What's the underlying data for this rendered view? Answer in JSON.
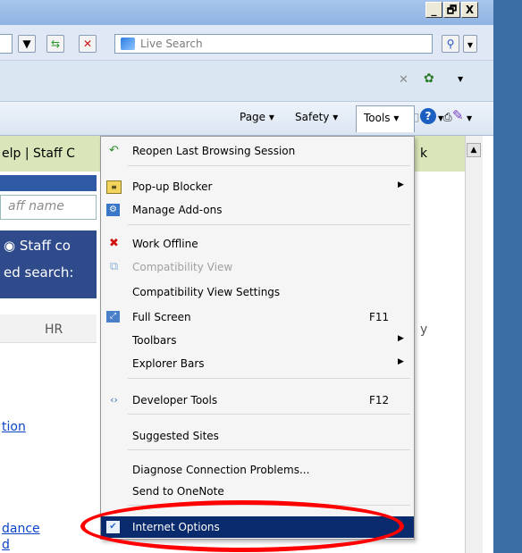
{
  "window": {
    "min_label": "_",
    "max_label": "🗗",
    "close_label": "X"
  },
  "search": {
    "placeholder": "Live Search"
  },
  "command_bar": {
    "page_label": "Page",
    "safety_label": "Safety",
    "tools_label": "Tools"
  },
  "page": {
    "nav_text": "elp",
    "nav_text2": "Staff C",
    "nav_text3": "k",
    "staff_placeholder": "aff name",
    "radio_text": "Staff co",
    "search_label": "ed search:",
    "hr_label": "HR",
    "y_label": "y",
    "link1": "tion",
    "link2": "dance",
    "link3": "d"
  },
  "menu": {
    "items": [
      {
        "label": "Reopen Last Browsing Session",
        "shortcut": "",
        "submenu": false,
        "disabled": false,
        "icon": "reopen-session-icon"
      },
      {
        "label": "Pop-up Blocker",
        "shortcut": "",
        "submenu": true,
        "disabled": false,
        "icon": "popup-blocker-icon"
      },
      {
        "label": "Manage Add-ons",
        "shortcut": "",
        "submenu": false,
        "disabled": false,
        "icon": "addons-icon"
      },
      {
        "label": "Work Offline",
        "shortcut": "",
        "submenu": false,
        "disabled": false,
        "icon": "work-offline-icon"
      },
      {
        "label": "Compatibility View",
        "shortcut": "",
        "submenu": false,
        "disabled": true,
        "icon": "compatibility-icon"
      },
      {
        "label": "Compatibility View Settings",
        "shortcut": "",
        "submenu": false,
        "disabled": false,
        "icon": ""
      },
      {
        "label": "Full Screen",
        "shortcut": "F11",
        "submenu": false,
        "disabled": false,
        "icon": "fullscreen-icon"
      },
      {
        "label": "Toolbars",
        "shortcut": "",
        "submenu": true,
        "disabled": false,
        "icon": ""
      },
      {
        "label": "Explorer Bars",
        "shortcut": "",
        "submenu": true,
        "disabled": false,
        "icon": ""
      },
      {
        "label": "Developer Tools",
        "shortcut": "F12",
        "submenu": false,
        "disabled": false,
        "icon": "developer-tools-icon"
      },
      {
        "label": "Suggested Sites",
        "shortcut": "",
        "submenu": false,
        "disabled": false,
        "icon": ""
      },
      {
        "label": "Diagnose Connection Problems...",
        "shortcut": "",
        "submenu": false,
        "disabled": false,
        "icon": ""
      },
      {
        "label": "Send to OneNote",
        "shortcut": "",
        "submenu": false,
        "disabled": false,
        "icon": ""
      },
      {
        "label": "Internet Options",
        "shortcut": "",
        "submenu": false,
        "disabled": false,
        "icon": "internet-options-icon",
        "highlighted": true
      }
    ]
  },
  "colors": {
    "highlight": "#0a2a6e",
    "annotation": "#ff0000",
    "title_bar": "#a8c6ec"
  }
}
